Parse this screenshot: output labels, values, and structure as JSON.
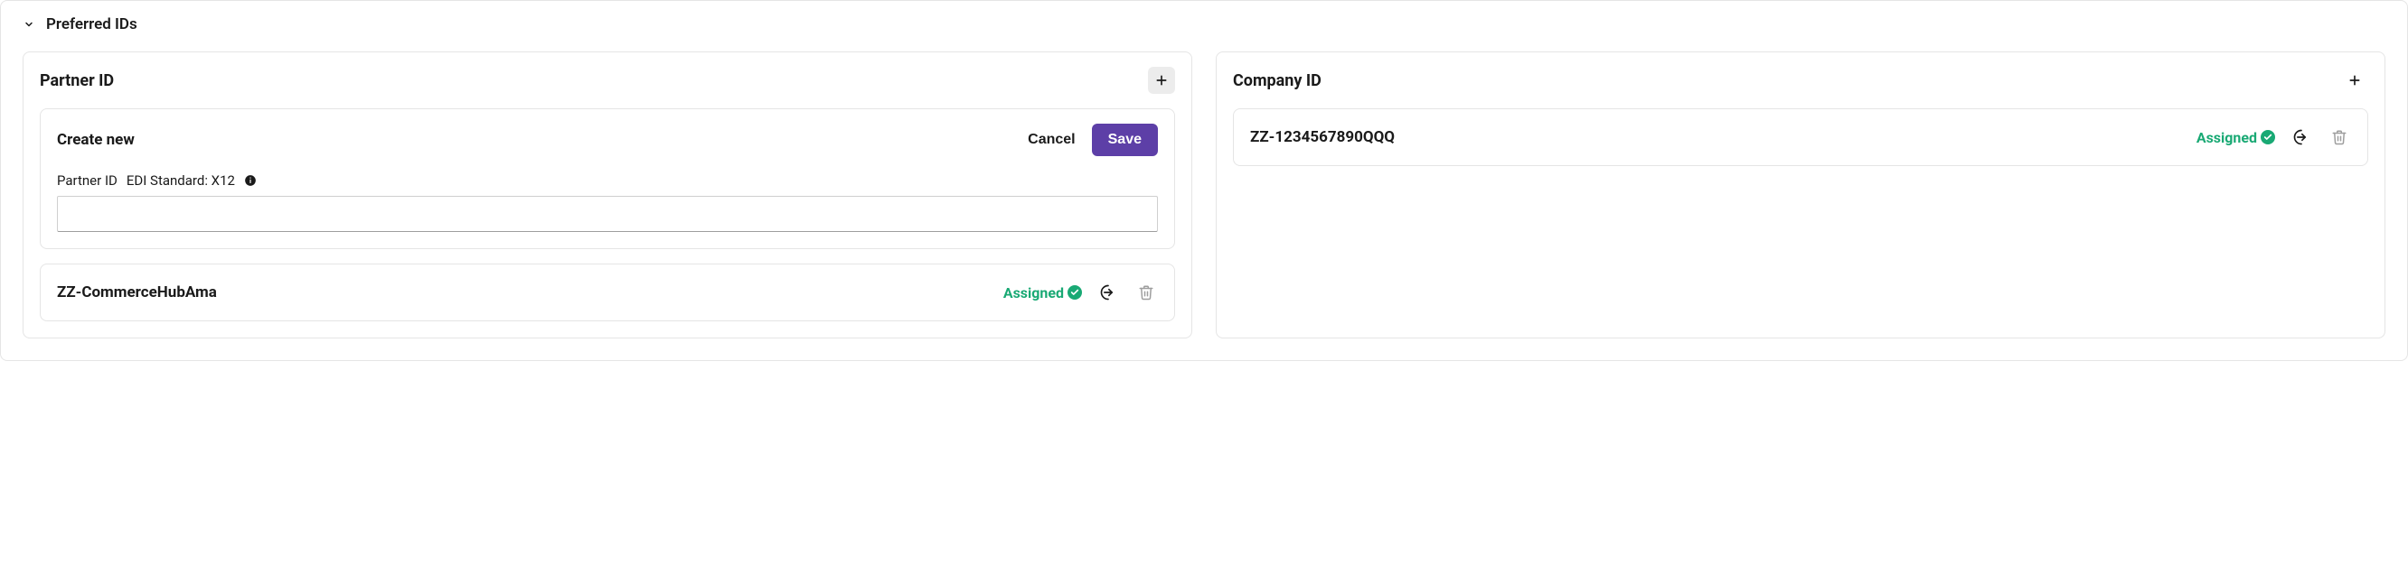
{
  "section": {
    "title": "Preferred IDs"
  },
  "partner": {
    "title": "Partner ID",
    "create": {
      "title": "Create new",
      "cancel_label": "Cancel",
      "save_label": "Save",
      "field_label": "Partner ID",
      "edi_label": "EDI Standard: X12",
      "value": ""
    },
    "rows": [
      {
        "value": "ZZ-CommerceHubAma",
        "status": "Assigned"
      }
    ]
  },
  "company": {
    "title": "Company ID",
    "rows": [
      {
        "value": "ZZ-1234567890QQQ",
        "status": "Assigned"
      }
    ]
  }
}
